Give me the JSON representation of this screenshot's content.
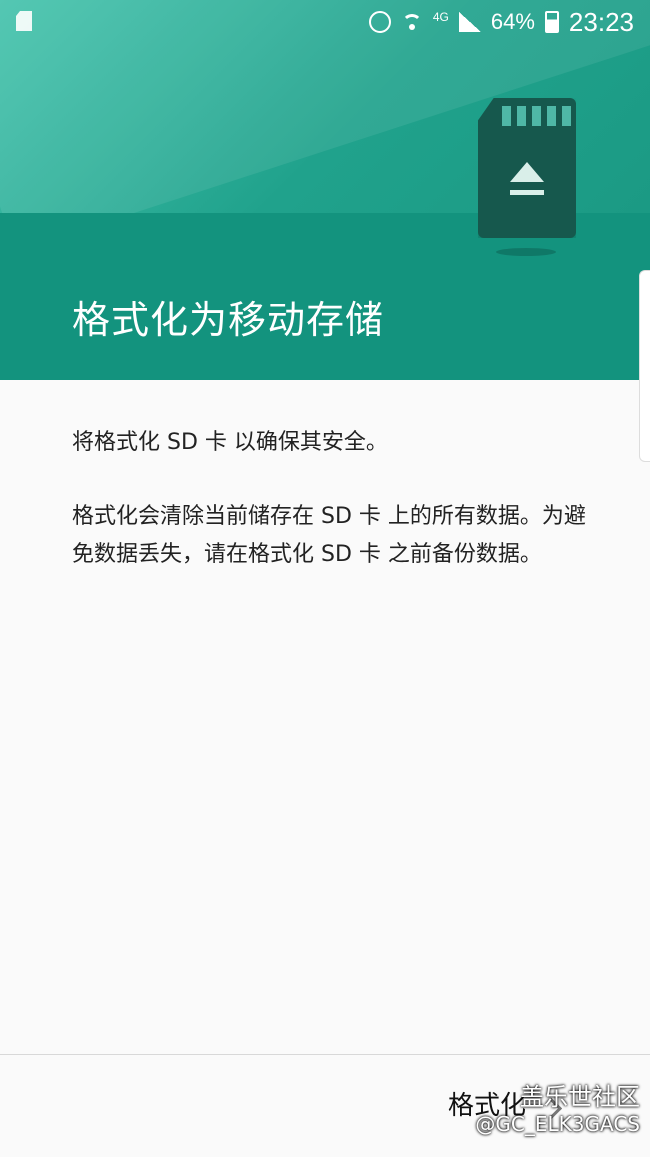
{
  "status_bar": {
    "battery_percent": "64%",
    "time": "23:23",
    "network_label": "4G",
    "icons": [
      "sd-card-icon",
      "alarm-icon",
      "wifi-icon",
      "signal-icon",
      "battery-icon"
    ]
  },
  "header": {
    "title": "格式化为移动存储",
    "illustration": "sd-card-eject-icon",
    "colors": {
      "top": "#2fb29b",
      "bottom": "#13937e",
      "card": "#16584d"
    }
  },
  "content": {
    "paragraph1": "将格式化 SD 卡 以确保其安全。",
    "paragraph2": "格式化会清除当前储存在 SD 卡 上的所有数据。为避免数据丢失，请在格式化 SD 卡 之前备份数据。"
  },
  "footer": {
    "format_button_label": "格式化",
    "chevron": "chevron-right-icon"
  },
  "watermark": {
    "name": "盖乐世社区",
    "handle": "@GC_ELK3GACS"
  }
}
